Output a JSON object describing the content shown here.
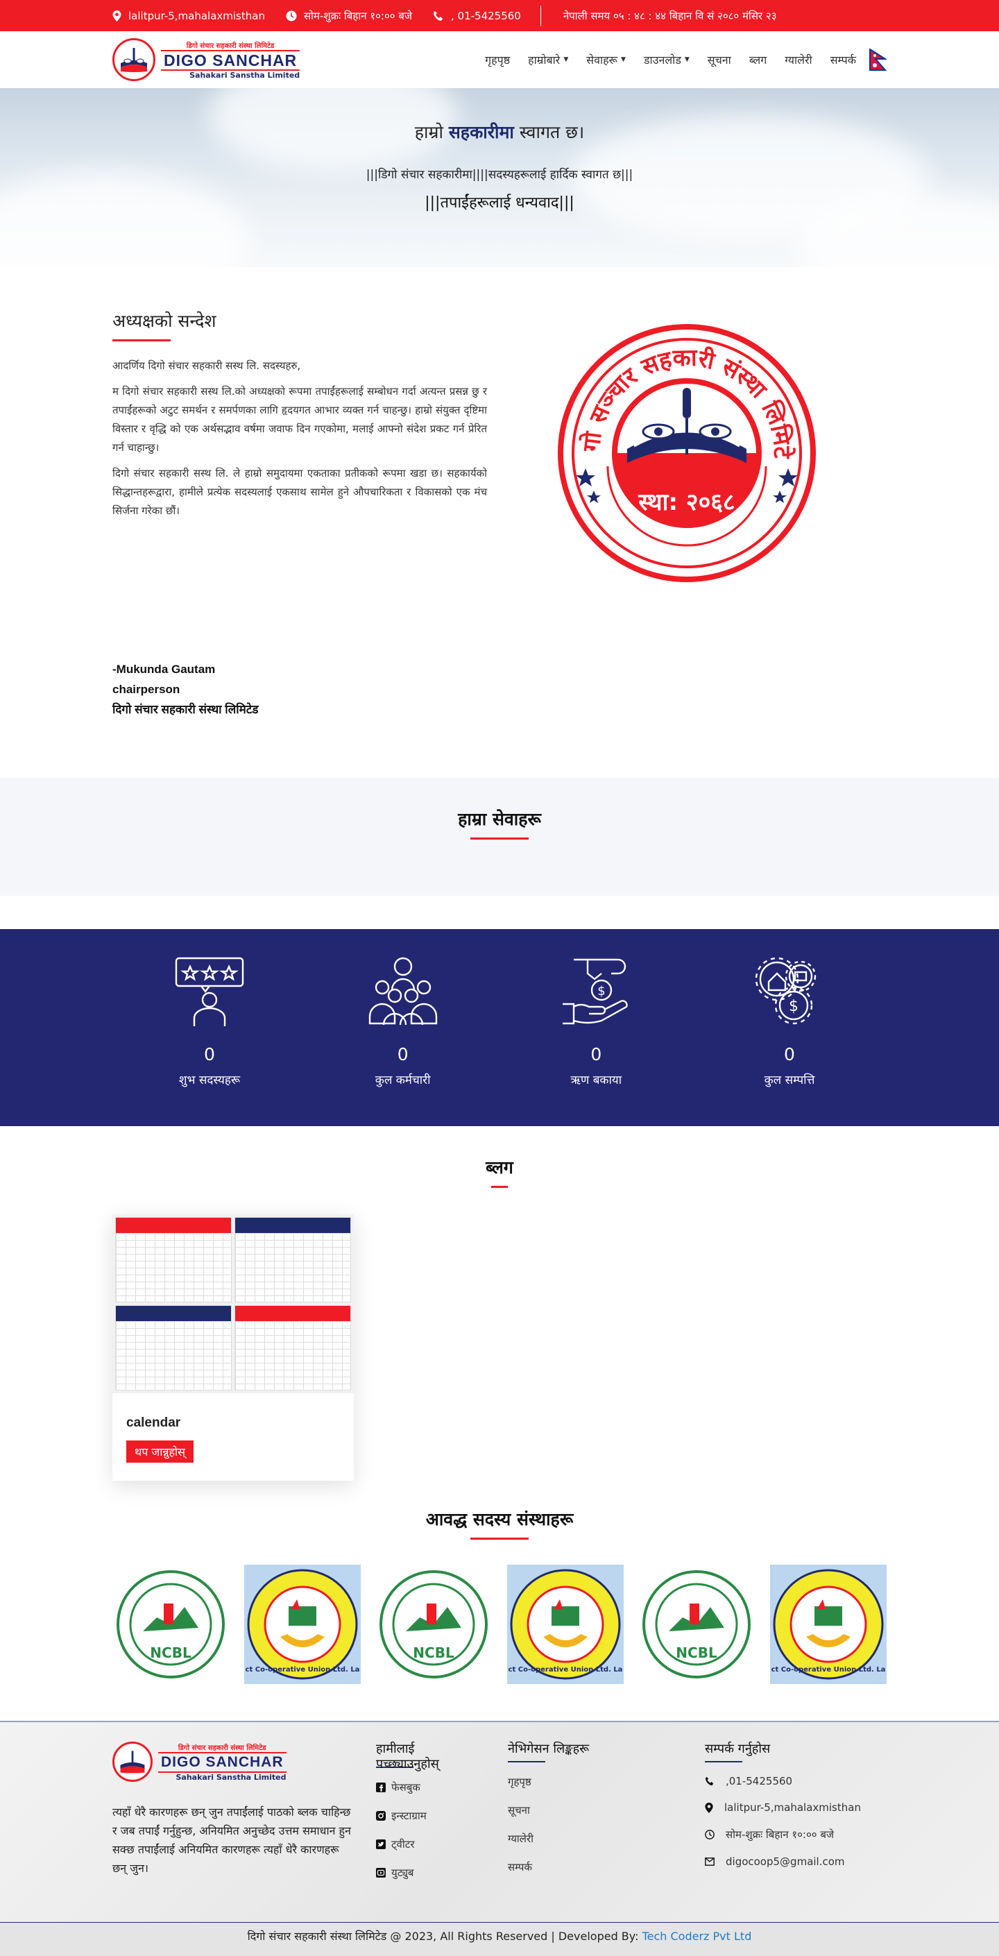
{
  "topbar": {
    "address": "lalitpur-5,mahalaxmisthan",
    "hours": "सोम-शुक्रः बिहान १०:०० बजे",
    "phone": ", 01-5425560",
    "nepali_time": "नेपाली समय ०५ : ४८ : ४४ बिहान   वि सं २०८० मंसिर २३"
  },
  "logo": {
    "np_text": "डिगो संचार सहकारी संस्था लिमिटेड",
    "name": "DIGO SANCHAR",
    "sub": "Sahakari Sanstha Limited",
    "estd": "स्था. २०६८"
  },
  "nav": {
    "items": [
      {
        "label": "गृहपृष्ठ",
        "dropdown": false
      },
      {
        "label": "हाम्रोबारे",
        "dropdown": true
      },
      {
        "label": "सेवाहरू",
        "dropdown": true
      },
      {
        "label": "डाउनलोड",
        "dropdown": true
      },
      {
        "label": "सूचना",
        "dropdown": false
      },
      {
        "label": "ब्लग",
        "dropdown": false
      },
      {
        "label": "ग्यालेरी",
        "dropdown": false
      },
      {
        "label": "सम्पर्क",
        "dropdown": false
      }
    ]
  },
  "hero": {
    "title_pre": "हाम्रो ",
    "title_highlight": "सहकारीमा",
    "title_post": " स्वागत छ।",
    "subtitle": "|||डिगो संचार सहकारीमा||||सदस्यहरूलाई हार्दिक स्वागत छ|||",
    "thanks": "|||तपाईंहरूलाई धन्यवाद|||"
  },
  "message": {
    "title": "अध्यक्षको सन्देश",
    "greeting": "आदर्णिय दिगो संचार सहकारी सस्थ लि. सदस्यहरु,",
    "para1": "म दिगो संचार सहकारी सस्थ लि.को अध्यक्षको रूपमा तपाईंहरूलाई सम्बोधन गर्दा अत्यन्त प्रसन्न छु र तपाईंहरूको अटुट समर्थन र समर्पणका लागि हृदयगत आभार व्यक्त गर्न चाहन्छु। हाम्रो संयुक्त दृष्टिमा विस्तार र वृद्धि को एक अर्थसद्भाव वर्षमा जवाफ दिन गएकोमा, मलाई आफ्नो संदेश प्रकट गर्न प्रेरित गर्न चाहान्छु।",
    "para2": "दिगो संचार सहकारी सस्थ लि. ले हाम्रो समुदायमा एकताका प्रतीकको रूपमा खडा छ। सहकार्यको सिद्धान्तहरूद्वारा, हामीले प्रत्येक सदस्यलाई एकसाथ सामेल हुने औपचारिकता र विकासको एक मंच सिर्जना गरेका छौं।",
    "sign_name": "-Mukunda Gautam",
    "sign_role": "chairperson",
    "sign_org": "दिगो संचार सहकारी संस्था लिमिटेड",
    "seal_text": "डिगो सञ्चार सहकारी संस्था लिमिटेड",
    "seal_estd": "स्था: २०६८"
  },
  "services": {
    "title": "हाम्रा सेवाहरू"
  },
  "stats": [
    {
      "icon": "rating-person-icon",
      "value": "0",
      "label": "शुभ सदस्यहरू"
    },
    {
      "icon": "team-icon",
      "value": "0",
      "label": "कुल कर्मचारी"
    },
    {
      "icon": "loan-hand-icon",
      "value": "0",
      "label": "ऋण बकाया"
    },
    {
      "icon": "assets-gear-icon",
      "value": "0",
      "label": "कुल सम्पत्ति"
    }
  ],
  "blog": {
    "title": "ब्लग",
    "card_title": "calendar",
    "card_button": "थप जान्नुहोस्"
  },
  "members": {
    "title": "आवद्ध सदस्य संस्थाहरू",
    "ncbl_text": "NCBL",
    "dcu_text": "District Co-operative Union Ltd. Lalitpur"
  },
  "footer": {
    "about": "त्यहाँ धेरै कारणहरू छन् जुन तपाईंलाई पाठको ब्लक चाहिन्छ र जब तपाईं गर्नुहुन्छ, अनियमित अनुच्छेद उत्तम समाधान हुन सक्छ तपाईंलाई अनियमित कारणहरू त्यहाँ धेरै कारणहरू छन् जुन।",
    "follow_title_1": "हामीलाई",
    "follow_title_2": "पच्छ्याउनुहोस्",
    "social": [
      "फेसबुक",
      "इन्स्टाग्राम",
      "ट्वीटर",
      "युट्युब"
    ],
    "nav_title": "नेभिगेसन लिङ्कहरू",
    "nav_links": [
      "गृहपृष्ठ",
      "सूचना",
      "ग्यालेरी",
      "सम्पर्क"
    ],
    "contact_title": "सम्पर्क गर्नुहोस",
    "phone": ",01-5425560",
    "address": "lalitpur-5,mahalaxmisthan",
    "hours": "सोम-शुक्रः बिहान १०:०० बजे",
    "email": "digocoop5@gmail.com"
  },
  "bottom": {
    "copyright": "दिगो संचार सहकारी संस्था लिमिटेड @ 2023, All Rights Reserved | Developed By: ",
    "developer": "Tech Coderz Pvt Ltd"
  },
  "colors": {
    "primary_red": "#ee1c25",
    "navy": "#232670"
  }
}
